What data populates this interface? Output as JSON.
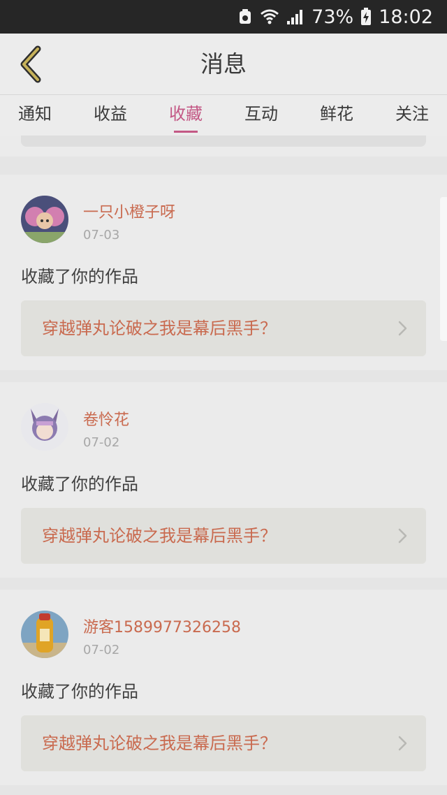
{
  "status_bar": {
    "battery_percent": "73%",
    "time": "18:02"
  },
  "header": {
    "title": "消息"
  },
  "tabs": [
    {
      "label": "通知"
    },
    {
      "label": "收益"
    },
    {
      "label": "收藏",
      "active": true
    },
    {
      "label": "互动"
    },
    {
      "label": "鲜花"
    },
    {
      "label": "关注"
    }
  ],
  "notifications": [
    {
      "user": "一只小橙子呀",
      "date": "07-03",
      "action": "收藏了你的作品",
      "work_title": "穿越弹丸论破之我是幕后黑手？"
    },
    {
      "user": "卷怜花",
      "date": "07-02",
      "action": "收藏了你的作品",
      "work_title": "穿越弹丸论破之我是幕后黑手？"
    },
    {
      "user": "游客1589977326258",
      "date": "07-02",
      "action": "收藏了你的作品",
      "work_title": "穿越弹丸论破之我是幕后黑手？"
    }
  ],
  "colors": {
    "accent": "#c35885",
    "link": "#c96a4f"
  }
}
